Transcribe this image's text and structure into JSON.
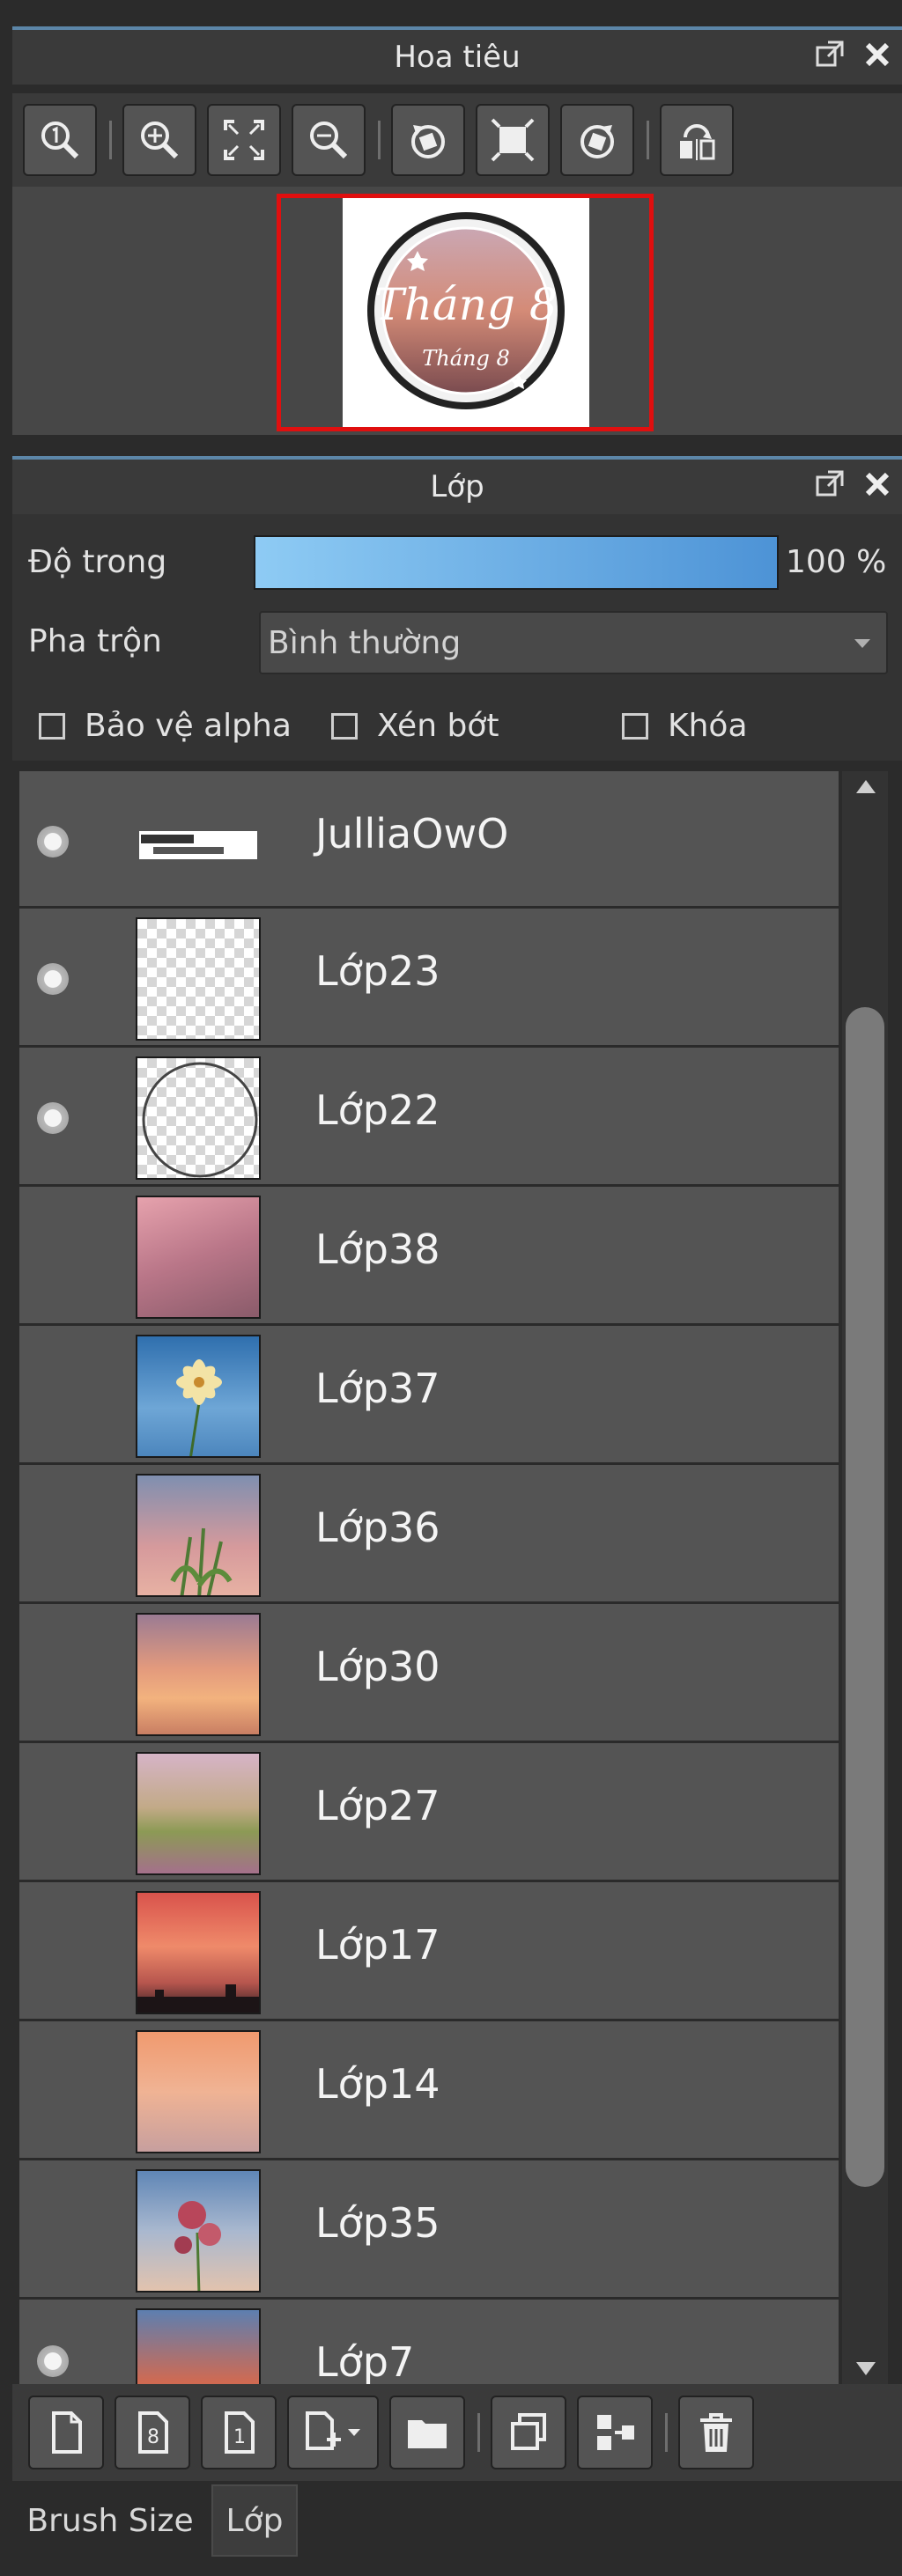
{
  "navigator": {
    "title": "Hoa tiêu",
    "preview_text": "Tháng 8"
  },
  "layers_panel": {
    "title": "Lớp",
    "opacity_label": "Độ trong",
    "opacity_value": "100 %",
    "blend_label": "Pha trộn",
    "blend_value": "Bình thường",
    "checkbox_alpha": "Bảo vệ alpha",
    "checkbox_clip": "Xén bớt",
    "checkbox_lock": "Khóa"
  },
  "layers": [
    {
      "name": "JulliaOwO",
      "visible": true
    },
    {
      "name": "Lớp23",
      "visible": true
    },
    {
      "name": "Lớp22",
      "visible": true
    },
    {
      "name": "Lớp38",
      "visible": false
    },
    {
      "name": "Lớp37",
      "visible": false
    },
    {
      "name": "Lớp36",
      "visible": false
    },
    {
      "name": "Lớp30",
      "visible": false
    },
    {
      "name": "Lớp27",
      "visible": false
    },
    {
      "name": "Lớp17",
      "visible": false
    },
    {
      "name": "Lớp14",
      "visible": false
    },
    {
      "name": "Lớp35",
      "visible": false
    },
    {
      "name": "Lớp7",
      "visible": true
    }
  ],
  "tabs": {
    "brush_size": "Brush Size",
    "layers": "Lớp"
  },
  "colors": {
    "panel_bg": "#3a3a3a",
    "row_bg": "#545454",
    "accent": "#5c86a8",
    "frame": "#e00f0f",
    "opacity_bar": "#5aa3e0"
  }
}
